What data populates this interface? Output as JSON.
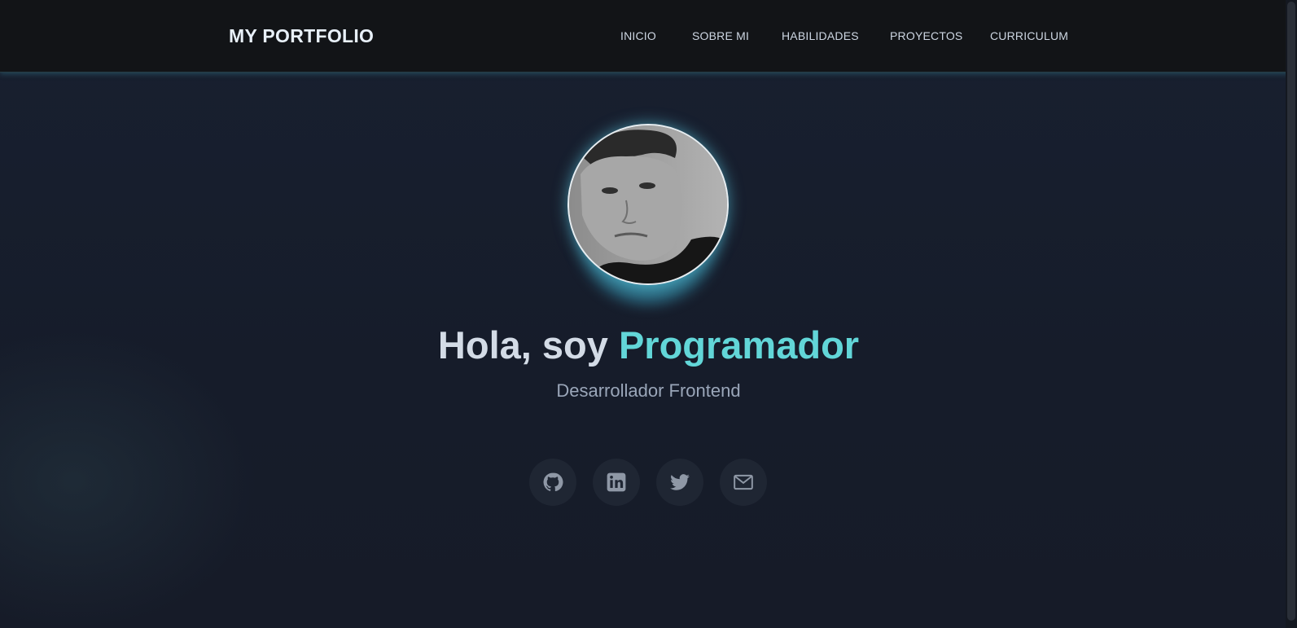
{
  "header": {
    "logo": "MY PORTFOLIO",
    "nav": [
      {
        "label": "INICIO"
      },
      {
        "label": "SOBRE MI"
      },
      {
        "label": "HABILIDADES"
      },
      {
        "label": "PROYECTOS"
      },
      {
        "label": "CURRICULUM"
      }
    ]
  },
  "hero": {
    "title_prefix": "Hola, soy ",
    "title_accent": "Programador",
    "subtitle": "Desarrollador Frontend",
    "avatar_icon": "profile-photo"
  },
  "socials": [
    {
      "icon": "github-icon"
    },
    {
      "icon": "linkedin-icon"
    },
    {
      "icon": "twitter-icon"
    },
    {
      "icon": "mail-icon"
    }
  ],
  "colors": {
    "accent": "#62d6d8",
    "header_bg": "#121417",
    "page_bg": "#161d29",
    "title_text": "#d3dbe6",
    "subtitle_text": "#9aa6b9",
    "icon": "#8f98a6"
  }
}
